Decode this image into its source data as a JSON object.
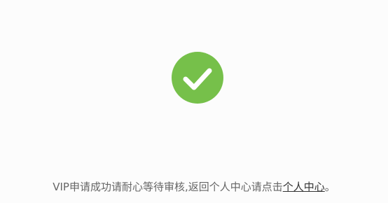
{
  "success": {
    "icon": "checkmark-icon",
    "color": "#76c04a"
  },
  "message": {
    "text": "VIP申请成功请耐心等待审核,返回个人中心请点击",
    "link_label": "个人中心",
    "suffix": "。"
  }
}
